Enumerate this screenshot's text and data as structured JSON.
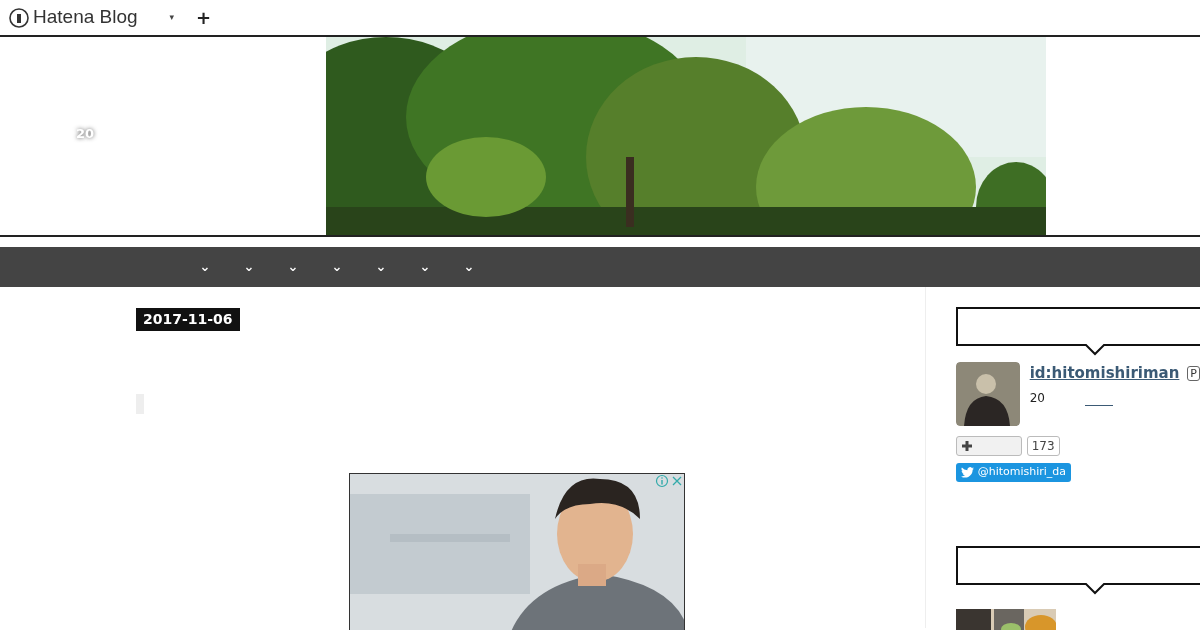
{
  "topbar": {
    "logo": "Hatena Blog",
    "menu_caret": "▾",
    "add": "+"
  },
  "header": {
    "blog_title": "20"
  },
  "nav": {
    "items": [
      {
        "caret": "⌄"
      },
      {
        "caret": "⌄"
      },
      {
        "caret": "⌄"
      },
      {
        "caret": "⌄"
      },
      {
        "caret": "⌄"
      },
      {
        "caret": "⌄"
      },
      {
        "caret": "⌄"
      }
    ]
  },
  "entry": {
    "date": "2017-11-06"
  },
  "sidebar": {
    "profile": {
      "id": "id:hitomishiriman",
      "badge": "P",
      "text": "20",
      "follow_count": "173",
      "twitter": "@hitomishiri_da"
    }
  }
}
